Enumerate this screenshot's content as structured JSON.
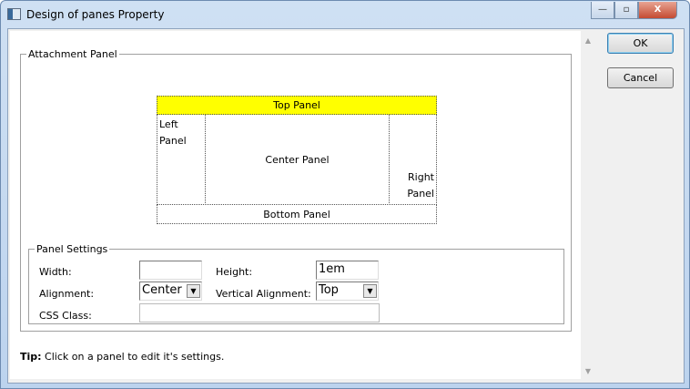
{
  "window": {
    "title": "Design of panes Property",
    "minimize": "—",
    "maximize": "▫",
    "close": "X"
  },
  "attachment": {
    "legend": "Attachment Panel",
    "top": "Top Panel",
    "left": "Left Panel",
    "center": "Center Panel",
    "right": "Right Panel",
    "bottom": "Bottom Panel",
    "top_color": "#ffff00"
  },
  "settings": {
    "legend": "Panel Settings",
    "width_label": "Width:",
    "width_value": "",
    "height_label": "Height:",
    "height_value": "1em",
    "alignment_label": "Alignment:",
    "alignment_value": "Center",
    "valign_label": "Vertical Alignment:",
    "valign_value": "Top",
    "css_label": "CSS Class:",
    "css_value": ""
  },
  "tip": {
    "prefix": "Tip:",
    "text": " Click on a panel to edit it's settings."
  },
  "buttons": {
    "ok": "OK",
    "cancel": "Cancel"
  }
}
